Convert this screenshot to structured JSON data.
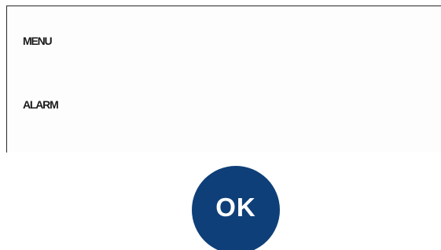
{
  "panel": {
    "items": [
      {
        "label": "MENU"
      },
      {
        "label": "ALARM"
      }
    ]
  },
  "ok_button": {
    "label": "OK",
    "color": "#0e3f78"
  }
}
